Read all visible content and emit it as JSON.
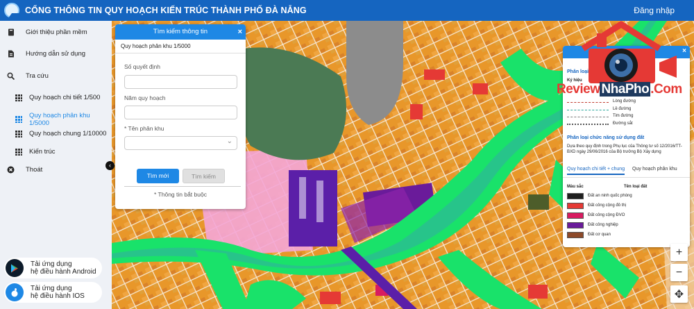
{
  "header": {
    "title": "CỔNG THÔNG TIN QUY HOẠCH KIẾN TRÚC THÀNH PHỐ ĐÀ NẴNG",
    "login": "Đăng nhập"
  },
  "sidebar": {
    "items": [
      {
        "label": "Giới thiệu phần mềm",
        "icon": "book-icon"
      },
      {
        "label": "Hướng dẫn sử dụng",
        "icon": "document-icon"
      },
      {
        "label": "Tra cứu",
        "icon": "search-icon"
      }
    ],
    "sub_items": [
      {
        "label": "Quy hoạch chi tiết 1/500",
        "active": false
      },
      {
        "label": "Quy hoạch phân khu 1/5000",
        "active": true
      },
      {
        "label": "Quy hoạch chung 1/10000",
        "active": false
      },
      {
        "label": "Kiến trúc",
        "active": false
      }
    ],
    "exit": "Thoát",
    "apps": [
      {
        "line1": "Tải ứng dụng",
        "line2": "hệ điều hành Android",
        "icon": "play-store-icon",
        "color": "#0d1b2a"
      },
      {
        "line1": "Tải ứng dụng",
        "line2": "hệ điều hành IOS",
        "icon": "apple-icon",
        "color": "#1e88e5"
      }
    ]
  },
  "search_panel": {
    "title": "Tìm kiếm thông tin",
    "close": "×",
    "subtitle": "Quy hoạch phân khu 1/5000",
    "fields": [
      {
        "label": "Số quyết định",
        "value": ""
      },
      {
        "label": "Năm quy hoạch",
        "value": ""
      },
      {
        "label": "* Tên phân khu",
        "value": ""
      }
    ],
    "btn_new": "Tìm mới",
    "btn_search": "Tìm kiếm",
    "required_note": "* Thông tin bắt buộc"
  },
  "legend": {
    "close": "×",
    "section1": "Phân loại",
    "symbol_header": "Ký hiệu",
    "lines": [
      {
        "label": "Lòng đường",
        "color": "#c0392b",
        "style": "dashed"
      },
      {
        "label": "Lề đường",
        "color": "#26a69a",
        "style": "dashed"
      },
      {
        "label": "Tim đường",
        "color": "#777777",
        "style": "dashed"
      },
      {
        "label": "Đường sắt",
        "color": "#555555",
        "style": "dotted"
      }
    ],
    "section2": "Phân loại chức năng sử dụng đất",
    "note": "Dựa theo quy định trong Phụ lục của Thông tư số 12/2016/TT-BXD ngày 29/06/2016 của Bộ trưởng Bộ Xây dựng",
    "tabs": [
      "Quy hoạch chi tiết + chung",
      "Quy hoạch phân khu"
    ],
    "col_color": "Màu sắc",
    "col_type": "Tên loại đất",
    "land_types": [
      {
        "label": "Đất an ninh quốc phòng",
        "color": "#1f1f1f"
      },
      {
        "label": "Đất công cộng đô thị",
        "color": "#e53935"
      },
      {
        "label": "Đất công cộng ĐVO",
        "color": "#d81b60"
      },
      {
        "label": "Đất công nghiệp",
        "color": "#6a1b9a"
      },
      {
        "label": "Đất cơ quan",
        "color": "#8d4a2a"
      }
    ]
  },
  "watermark": {
    "review": "Review",
    "nhapho": "NhaPho",
    "com": ".Com"
  },
  "map_controls": {
    "zoom_in": "+",
    "zoom_out": "−",
    "move": "✥"
  },
  "colors": {
    "primary": "#1565c0",
    "accent": "#1e88e5",
    "map_base": "#e89a2a",
    "green": "#19e26a",
    "water": "#27c48a"
  }
}
